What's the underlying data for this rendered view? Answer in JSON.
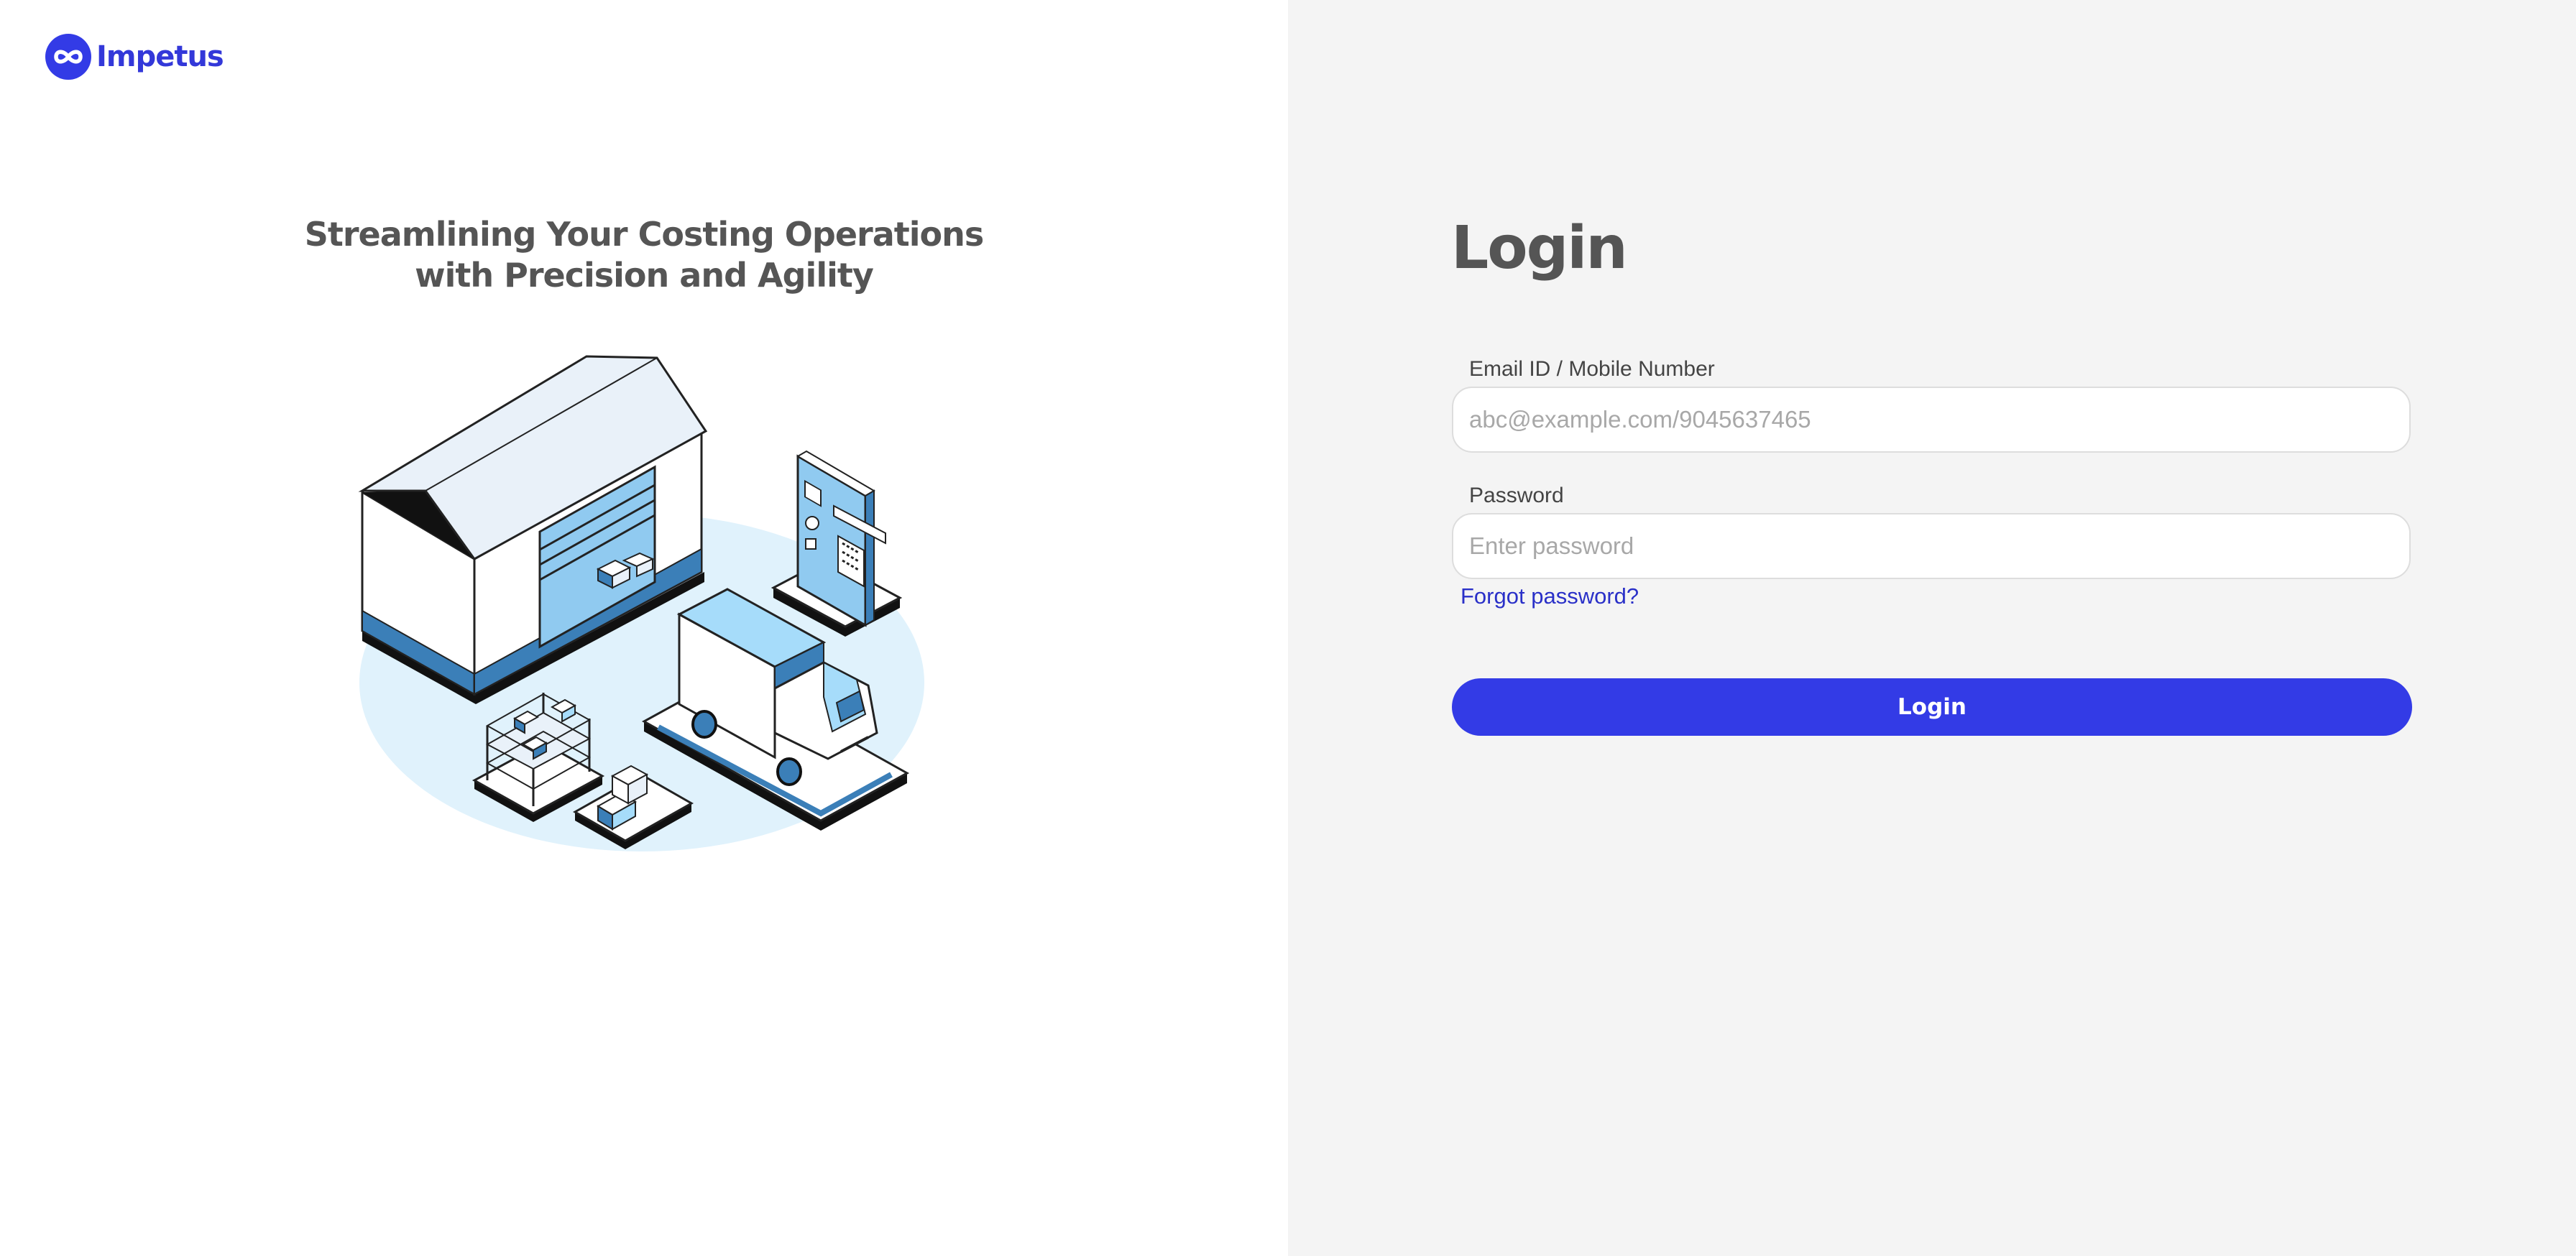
{
  "brand": {
    "name": "Impetus",
    "accent": "#333be6",
    "icon": "infinity-logo-icon"
  },
  "hero": {
    "headline_line1": "Streamlining Your Costing Operations",
    "headline_line2": "with Precision and Agility",
    "illustration": "warehouse-logistics-illustration"
  },
  "login": {
    "title": "Login",
    "email_label": "Email ID / Mobile Number",
    "email_placeholder": "abc@example.com/9045637465",
    "email_value": "",
    "password_label": "Password",
    "password_placeholder": "Enter password",
    "password_value": "",
    "forgot_label": "Forgot password?",
    "submit_label": "Login"
  },
  "colors": {
    "left_bg": "#ffffff",
    "right_bg": "#f4f4f4",
    "heading": "#555555",
    "link": "#2a30c8",
    "illustration_blob": "#e0f2fc"
  }
}
